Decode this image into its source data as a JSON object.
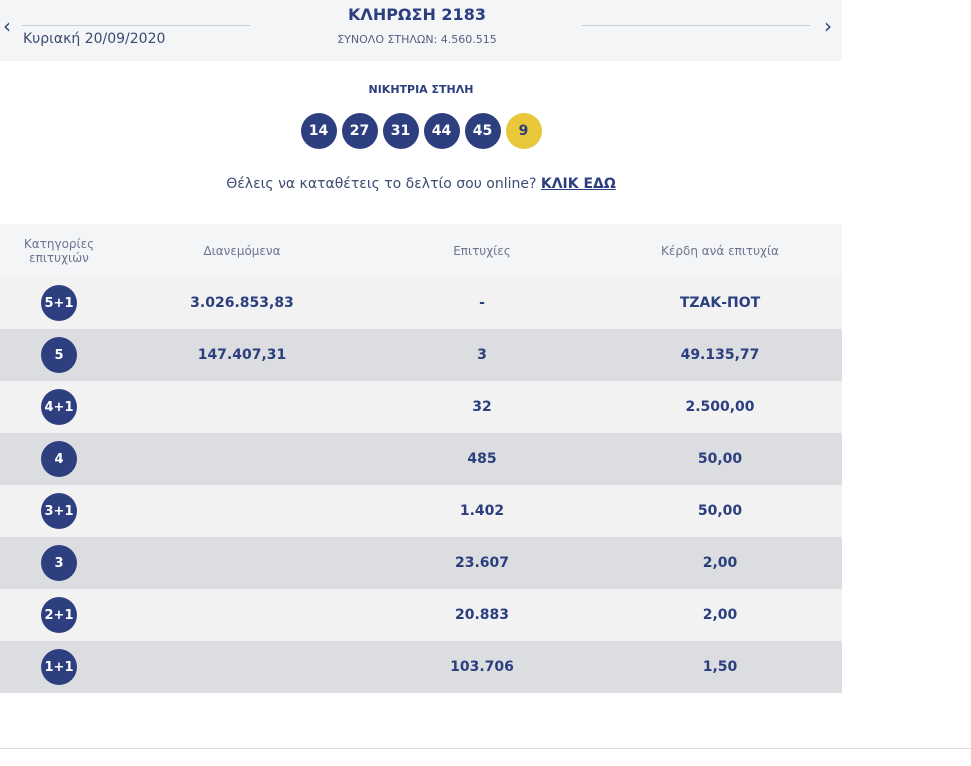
{
  "header": {
    "prev_arrow": "‹",
    "next_arrow": "›",
    "date": "Κυριακή 20/09/2020",
    "draw_title": "ΚΛΗΡΩΣΗ 2183",
    "total_columns": "ΣΥΝΟΛΟ ΣΤΗΛΩΝ: 4.560.515"
  },
  "winning": {
    "label": "ΝΙΚΗΤΡΙΑ ΣΤΗΛΗ",
    "numbers": [
      "14",
      "27",
      "31",
      "44",
      "45"
    ],
    "bonus": "9"
  },
  "online": {
    "text": "Θέλεις να καταθέτεις το δελτίο σου online? ",
    "link": "ΚΛΙΚ ΕΔΩ"
  },
  "table": {
    "headers": [
      "Κατηγορίες επιτυχιών",
      "Διανεμόμενα",
      "Επιτυχίες",
      "Κέρδη ανά επιτυχία"
    ],
    "rows": [
      {
        "category": "5+1",
        "distributed": "3.026.853,83",
        "winners": "-",
        "prize": "ΤΖΑΚ-ΠΟΤ"
      },
      {
        "category": "5",
        "distributed": "147.407,31",
        "winners": "3",
        "prize": "49.135,77"
      },
      {
        "category": "4+1",
        "distributed": "",
        "winners": "32",
        "prize": "2.500,00"
      },
      {
        "category": "4",
        "distributed": "",
        "winners": "485",
        "prize": "50,00"
      },
      {
        "category": "3+1",
        "distributed": "",
        "winners": "1.402",
        "prize": "50,00"
      },
      {
        "category": "3",
        "distributed": "",
        "winners": "23.607",
        "prize": "2,00"
      },
      {
        "category": "2+1",
        "distributed": "",
        "winners": "20.883",
        "prize": "2,00"
      },
      {
        "category": "1+1",
        "distributed": "",
        "winners": "103.706",
        "prize": "1,50"
      }
    ]
  },
  "colors": {
    "brand_navy": "#2e3f7f",
    "bonus_yellow": "#e8c73a",
    "row_light": "#f2f2f3",
    "row_dark": "#dcdde0"
  }
}
